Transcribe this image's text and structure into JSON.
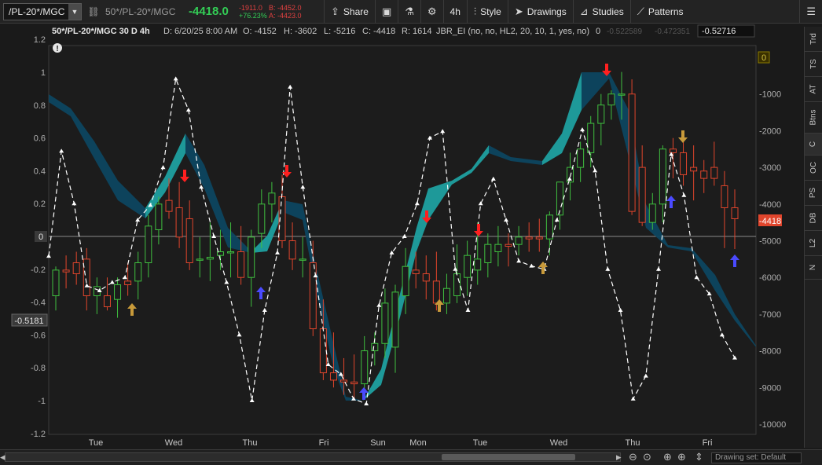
{
  "toolbar": {
    "symbol": "/PL-20*/MGC",
    "description": "50*/PL-20*/MGC",
    "last": "-4418.0",
    "net_change": "-1911.0",
    "pct_change": "+76.23%",
    "bid": "B: -4452.0",
    "ask": "A: -4423.0",
    "share_label": "Share",
    "period_label": "4h",
    "style_label": "Style",
    "drawings_label": "Drawings",
    "studies_label": "Studies",
    "patterns_label": "Patterns"
  },
  "chart_header": {
    "symbol": "50*/PL-20*/MGC 30 D 4h",
    "date": "D: 6/20/25 8:00 AM",
    "open": "O: -4152",
    "high": "H: -3602",
    "low": "L: -5216",
    "close": "C: -4418",
    "range": "R: 1614",
    "study": "JBR_EI (no, no, HL2, 20, 10, 1, yes, no)",
    "study_v1": "0",
    "study_v2": "-0.522589",
    "study_v3": "-0.472351",
    "study_v4": "-0.52716"
  },
  "side_tabs": [
    "Trd",
    "TS",
    "AT",
    "Btns",
    "C",
    "OC",
    "PS",
    "DB",
    "L2",
    "N"
  ],
  "bottom": {
    "drawing_set": "Drawing set: Default"
  },
  "chart_data": {
    "type": "line",
    "x_labels": [
      "Tue",
      "Wed",
      "Thu",
      "Fri",
      "Sun",
      "Mon",
      "Tue",
      "Wed",
      "Thu",
      "Fri"
    ],
    "left_axis": {
      "ticks": [
        "1.2",
        "1",
        "0.8",
        "0.6",
        "0.4",
        "0.2",
        "0",
        "-0.2",
        "-0.4",
        "-0.6",
        "-0.8",
        "-1",
        "-1.2"
      ],
      "range": [
        -1.2,
        1.2
      ],
      "current_label": "-0.5181"
    },
    "right_axis": {
      "ticks": [
        "0",
        "-1000",
        "-2000",
        "-3000",
        "-4000",
        "-5000",
        "-6000",
        "-7000",
        "-8000",
        "-9000",
        "-10000"
      ],
      "range": [
        -11000,
        1000
      ],
      "current_label": "-4418"
    },
    "colors": {
      "up": "#3fbf3f",
      "down": "#e0452c",
      "band_up": "#1fa0a0",
      "band_down": "#0d4660",
      "oscillator": "#ffffff",
      "arrow_red": "#ff2020",
      "arrow_blue": "#4a4aff",
      "arrow_gold": "#c89a3a"
    },
    "candles": [
      {
        "o": -6500,
        "h": -5700,
        "l": -6900,
        "c": -5800
      },
      {
        "o": -5800,
        "h": -5400,
        "l": -6300,
        "c": -5850
      },
      {
        "o": -5600,
        "h": -5300,
        "l": -6200,
        "c": -5900
      },
      {
        "o": -5500,
        "h": -5200,
        "l": -6900,
        "c": -6500
      },
      {
        "o": -6500,
        "h": -6000,
        "l": -7000,
        "c": -6250
      },
      {
        "o": -6500,
        "h": -6000,
        "l": -6900,
        "c": -6800
      },
      {
        "o": -6600,
        "h": -6000,
        "l": -7100,
        "c": -6200
      },
      {
        "o": -6100,
        "h": -5600,
        "l": -6500,
        "c": -6200
      },
      {
        "o": -6100,
        "h": -5300,
        "l": -6600,
        "c": -5600
      },
      {
        "o": -5600,
        "h": -4300,
        "l": -6000,
        "c": -4600
      },
      {
        "o": -4700,
        "h": -3800,
        "l": -5100,
        "c": -4000
      },
      {
        "o": -3900,
        "h": -3300,
        "l": -4400,
        "c": -4200
      },
      {
        "o": -4100,
        "h": -3400,
        "l": -5200,
        "c": -4900
      },
      {
        "o": -4400,
        "h": -3900,
        "l": -5800,
        "c": -5600
      },
      {
        "o": -5500,
        "h": -4900,
        "l": -6000,
        "c": -5500
      },
      {
        "o": -5500,
        "h": -4500,
        "l": -6100,
        "c": -5450
      },
      {
        "o": -5400,
        "h": -4700,
        "l": -5800,
        "c": -5300
      },
      {
        "o": -5300,
        "h": -4500,
        "l": -6000,
        "c": -5300
      },
      {
        "o": -5300,
        "h": -4600,
        "l": -6200,
        "c": -6000
      },
      {
        "o": -6000,
        "h": -4700,
        "l": -6800,
        "c": -4900
      },
      {
        "o": -4800,
        "h": -3600,
        "l": -5200,
        "c": -4000
      },
      {
        "o": -4000,
        "h": -3400,
        "l": -4500,
        "c": -3700
      },
      {
        "o": -3800,
        "h": -3200,
        "l": -5200,
        "c": -5000
      },
      {
        "o": -5000,
        "h": -4500,
        "l": -5800,
        "c": -5500
      },
      {
        "o": -5500,
        "h": -4900,
        "l": -6000,
        "c": -5500
      },
      {
        "o": -5600,
        "h": -5000,
        "l": -7600,
        "c": -7400
      },
      {
        "o": -7400,
        "h": -6600,
        "l": -8800,
        "c": -8600
      },
      {
        "o": -8600,
        "h": -7500,
        "l": -9000,
        "c": -8800
      },
      {
        "o": -8800,
        "h": -8200,
        "l": -9200,
        "c": -8850
      },
      {
        "o": -8850,
        "h": -8100,
        "l": -9300,
        "c": -8900
      },
      {
        "o": -8900,
        "h": -7600,
        "l": -9100,
        "c": -8000
      },
      {
        "o": -8000,
        "h": -7500,
        "l": -8400,
        "c": -7800
      },
      {
        "o": -7800,
        "h": -6300,
        "l": -8200,
        "c": -6700
      },
      {
        "o": -7900,
        "h": -6200,
        "l": -8600,
        "c": -6400
      },
      {
        "o": -6500,
        "h": -5200,
        "l": -7000,
        "c": -5700
      },
      {
        "o": -5800,
        "h": -5300,
        "l": -6300,
        "c": -5900
      },
      {
        "o": -5900,
        "h": -5400,
        "l": -6600,
        "c": -6100
      },
      {
        "o": -6100,
        "h": -5300,
        "l": -6900,
        "c": -6700
      },
      {
        "o": -6700,
        "h": -5900,
        "l": -7000,
        "c": -6300
      },
      {
        "o": -6500,
        "h": -5100,
        "l": -6700,
        "c": -5900
      },
      {
        "o": -6000,
        "h": -5000,
        "l": -6500,
        "c": -5400
      },
      {
        "o": -5800,
        "h": -4500,
        "l": -6200,
        "c": -5500
      },
      {
        "o": -5600,
        "h": -4800,
        "l": -6000,
        "c": -5100
      },
      {
        "o": -5300,
        "h": -4600,
        "l": -5700,
        "c": -5100
      },
      {
        "o": -5100,
        "h": -4800,
        "l": -5700,
        "c": -5150
      },
      {
        "o": -5100,
        "h": -4600,
        "l": -5400,
        "c": -4900
      },
      {
        "o": -4900,
        "h": -4500,
        "l": -5300,
        "c": -4950
      },
      {
        "o": -4900,
        "h": -4400,
        "l": -5300,
        "c": -4950
      },
      {
        "o": -4950,
        "h": -4200,
        "l": -5400,
        "c": -4300
      },
      {
        "o": -4300,
        "h": -3600,
        "l": -4700,
        "c": -3400
      },
      {
        "o": -3400,
        "h": -2600,
        "l": -3900,
        "c": -3000
      },
      {
        "o": -3000,
        "h": -2300,
        "l": -3400,
        "c": -2500
      },
      {
        "o": -2600,
        "h": -1600,
        "l": -3000,
        "c": -1800
      },
      {
        "o": -1800,
        "h": -1000,
        "l": -2400,
        "c": -1300
      },
      {
        "o": -1300,
        "h": -900,
        "l": -1700,
        "c": -1000
      },
      {
        "o": -1000,
        "h": -400,
        "l": -1700,
        "c": -1000
      },
      {
        "o": -1000,
        "h": -600,
        "l": -4300,
        "c": -4200
      },
      {
        "o": -3000,
        "h": -2400,
        "l": -4600,
        "c": -4500
      },
      {
        "o": -4500,
        "h": -3700,
        "l": -4700,
        "c": -4000
      },
      {
        "o": -4000,
        "h": -2400,
        "l": -4500,
        "c": -2500
      },
      {
        "o": -2500,
        "h": -2200,
        "l": -3300,
        "c": -2600
      },
      {
        "o": -2600,
        "h": -2300,
        "l": -3500,
        "c": -3200
      },
      {
        "o": -3000,
        "h": -2400,
        "l": -3900,
        "c": -3100
      },
      {
        "o": -3100,
        "h": -2800,
        "l": -3700,
        "c": -3300
      },
      {
        "o": -3000,
        "h": -2300,
        "l": -3500,
        "c": -3300
      },
      {
        "o": -3500,
        "h": -3100,
        "l": -5200,
        "c": -4100
      },
      {
        "o": -4100,
        "h": -3600,
        "l": -4600,
        "c": -4400
      }
    ],
    "oscillator": [
      -0.12,
      0.52,
      0.2,
      -0.3,
      -0.33,
      -0.28,
      -0.25,
      0.1,
      0.19,
      0.42,
      0.96,
      0.77,
      0.3,
      0.0,
      -0.28,
      -0.6,
      -1.0,
      -0.45,
      -0.1,
      0.91,
      0.3,
      -0.24,
      -0.78,
      -0.84,
      -0.99,
      -1.02,
      -0.42,
      -0.1,
      0.0,
      0.2,
      0.6,
      0.64,
      -0.2,
      -0.45,
      0.2,
      0.35,
      0.1,
      -0.15,
      -0.18,
      -0.2,
      0.1,
      0.35,
      0.65,
      0.4,
      -0.2,
      -0.45,
      -0.99,
      -0.85,
      -0.2,
      0.5,
      0.25,
      -0.25,
      -0.35,
      -0.6,
      -0.74
    ]
  }
}
